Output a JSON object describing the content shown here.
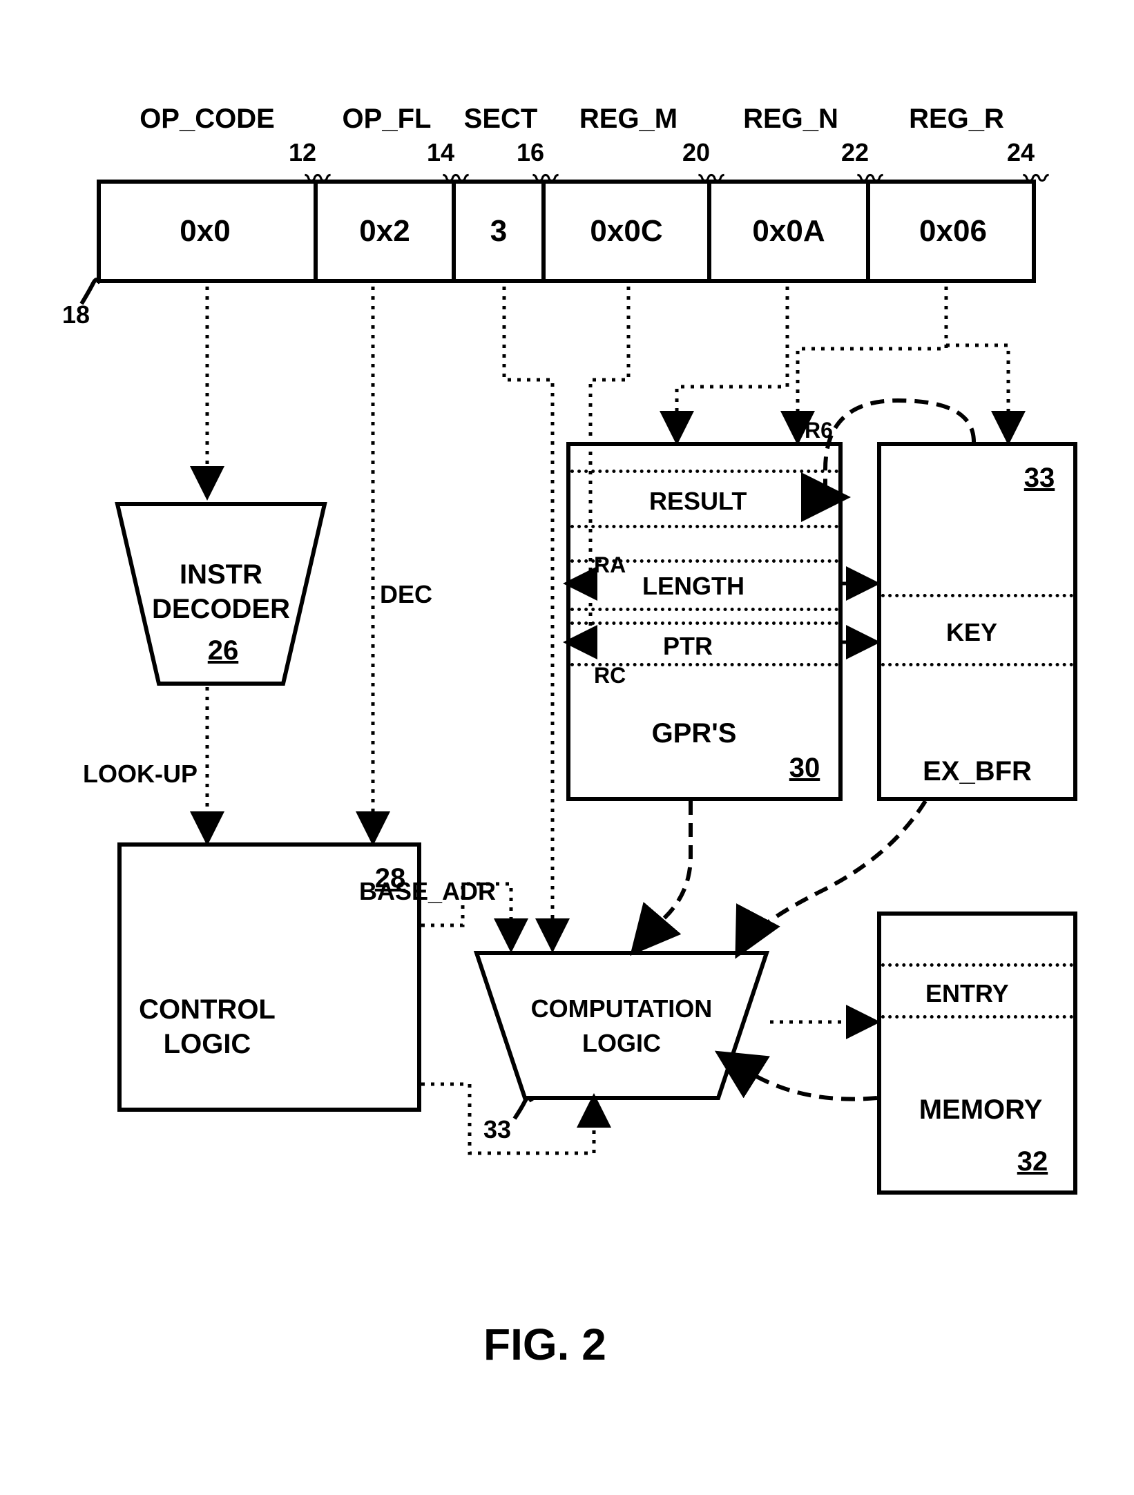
{
  "instruction": {
    "ref": "18",
    "fields": [
      {
        "name": "OP_CODE",
        "value": "0x0",
        "ref": "12"
      },
      {
        "name": "OP_FL",
        "value": "0x2",
        "ref": "14"
      },
      {
        "name": "SECT",
        "value": "3",
        "ref": "16"
      },
      {
        "name": "REG_M",
        "value": "0x0C",
        "ref": "20"
      },
      {
        "name": "REG_N",
        "value": "0x0A",
        "ref": "22"
      },
      {
        "name": "REG_R",
        "value": "0x06",
        "ref": "24"
      }
    ]
  },
  "blocks": {
    "decoder": {
      "line1": "INSTR",
      "line2": "DECODER",
      "ref": "26"
    },
    "control": {
      "line1": "CONTROL",
      "line2": "LOGIC",
      "ref": "28"
    },
    "gprs": {
      "title": "GPR'S",
      "ref": "30",
      "rows": {
        "result": "RESULT",
        "length": "LENGTH",
        "ptr": "PTR"
      },
      "ports": {
        "ra": "RA",
        "rc": "RC",
        "r6": "R6"
      }
    },
    "exbfr": {
      "title": "EX_BFR",
      "ref": "33",
      "key": "KEY"
    },
    "memory": {
      "title": "MEMORY",
      "ref": "32",
      "entry": "ENTRY"
    },
    "comp": {
      "line1": "COMPUTATION",
      "line2": "LOGIC",
      "ref": "33"
    }
  },
  "signals": {
    "dec": "DEC",
    "lookup": "LOOK-UP",
    "base_adr": "BASE_ADR"
  },
  "figure": "FIG. 2"
}
